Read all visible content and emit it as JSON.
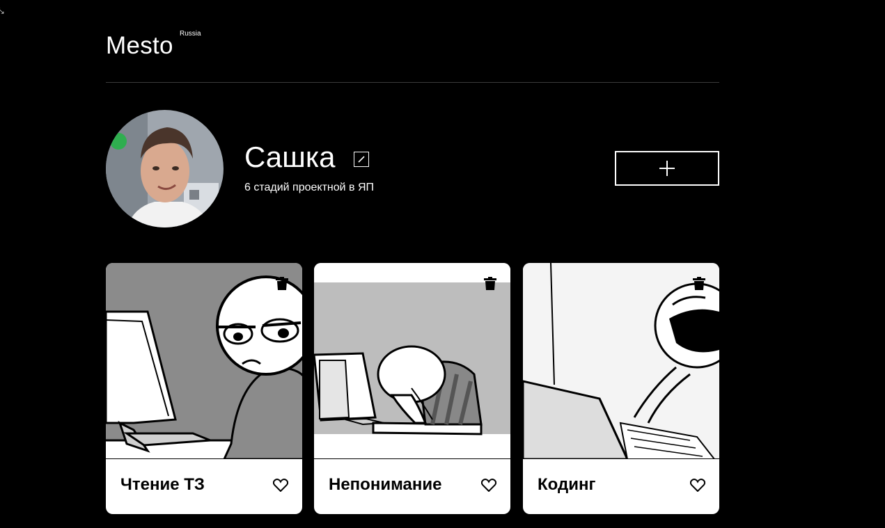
{
  "header": {
    "logo": "Mesto",
    "logo_sup": "Russia"
  },
  "profile": {
    "name": "Сашка",
    "about": "6 стадий проектной в ЯП",
    "edit_icon": "pencil-icon",
    "add_icon": "plus-icon"
  },
  "cards": [
    {
      "title": "Чтение ТЗ",
      "icon": "trash-icon",
      "like_icon": "heart-outline-icon"
    },
    {
      "title": "Непонимание",
      "icon": "trash-icon",
      "like_icon": "heart-outline-icon"
    },
    {
      "title": "Кодинг",
      "icon": "trash-icon",
      "like_icon": "heart-outline-icon"
    }
  ],
  "colors": {
    "background": "#000000",
    "text": "#ffffff",
    "card": "#ffffff",
    "card_text": "#000000"
  }
}
